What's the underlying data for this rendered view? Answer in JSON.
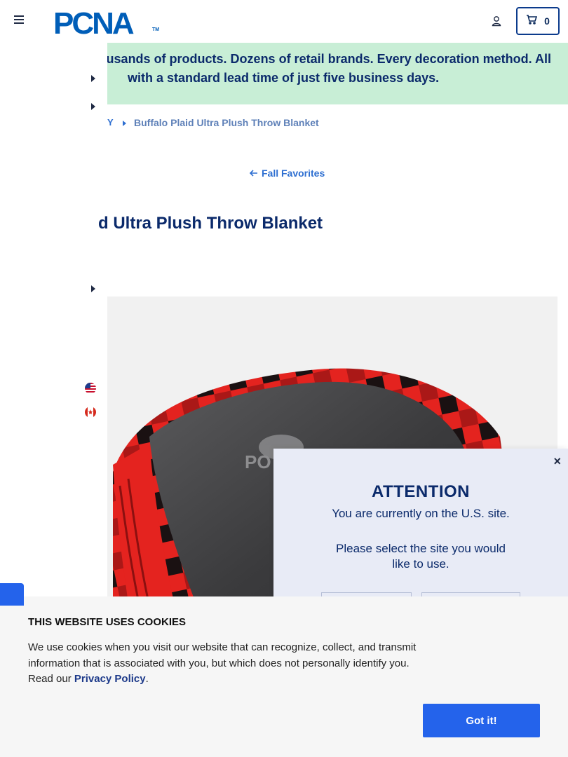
{
  "header": {
    "menu_icon": "hamburger-menu-icon",
    "logo_text": "PCNA",
    "logo_tm": "TM",
    "account_icon": "user-icon",
    "cart_icon": "cart-icon",
    "cart_count": "0"
  },
  "promo": {
    "line1": "usands of products. Dozens of retail brands. Every decoration method. All",
    "line2": "with a standard lead time of just five business days."
  },
  "breadcrumb": {
    "partial": "Y",
    "current": "Buffalo Plaid Ultra Plush Throw Blanket"
  },
  "back_link": {
    "icon": "arrow-left-icon",
    "label": "Fall Favorites"
  },
  "product": {
    "title": "d Ultra Plush Throw Blanket",
    "image_alt": "Buffalo plaid red and black blanket with grey fleece and embossed logo"
  },
  "flags": {
    "us_icon": "us-flag-icon",
    "ca_icon": "canada-flag-icon"
  },
  "attention_modal": {
    "close_symbol": "×",
    "title": "ATTENTION",
    "message_line1": "You are currently on the U.S. site.",
    "message_line2": "Please select the site you would like to use."
  },
  "cookie_banner": {
    "title": "THIS WEBSITE USES COOKIES",
    "body_prefix": "We use cookies when you visit our website that can recognize, collect, and transmit information that is associated with you, but which does not personally identify you. Read our ",
    "link_text": "Privacy Policy",
    "body_suffix": ".",
    "button_label": "Got it!"
  },
  "colors": {
    "brand_blue": "#005eb8",
    "navy": "#0b2a6b",
    "promo_bg": "#c8eed6",
    "link_blue": "#2e6fd1",
    "modal_bg": "#e8ebf6",
    "cookie_bg": "#f6f6f6",
    "button_blue": "#2463eb"
  }
}
